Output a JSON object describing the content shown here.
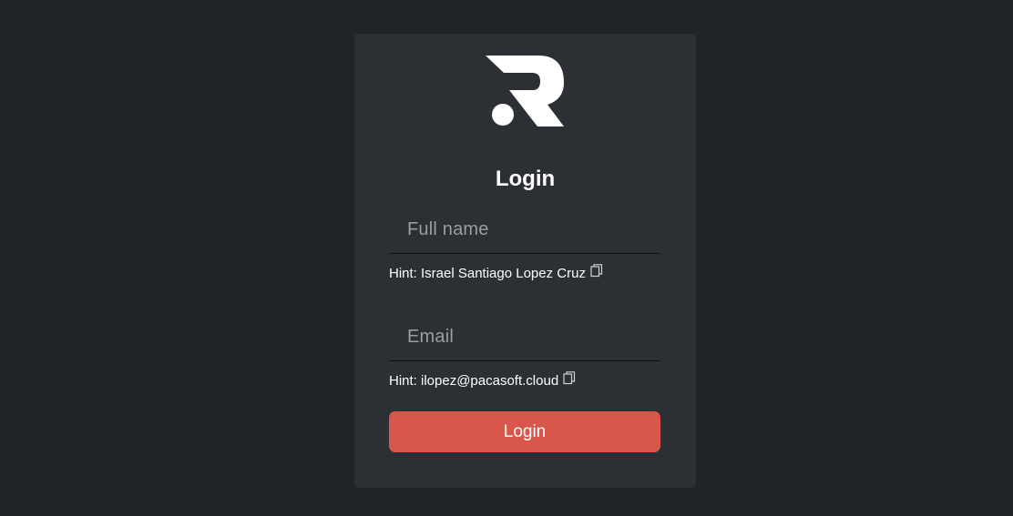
{
  "login_card": {
    "logo_icon": "r-brand-logo-icon",
    "title": "Login",
    "full_name": {
      "placeholder": "Full name",
      "value": "",
      "hint": "Hint: Israel Santiago Lopez Cruz",
      "copy_icon": "copy-icon"
    },
    "email": {
      "placeholder": "Email",
      "value": "",
      "hint": "Hint: ilopez@pacasoft.cloud",
      "copy_icon": "copy-icon"
    },
    "login_button_label": "Login"
  },
  "colors": {
    "page_background": "#212427",
    "card_background": "#2c2f34",
    "accent": "#d9574a",
    "text": "#ffffff",
    "placeholder": "#9a9da1"
  }
}
